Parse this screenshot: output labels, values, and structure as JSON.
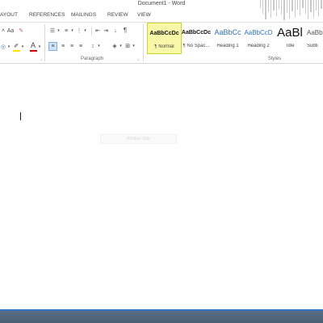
{
  "window": {
    "title": "Document1 - Word"
  },
  "ribbon_tabs": [
    "AYOUT",
    "REFERENCES",
    "MAILINGS",
    "REVIEW",
    "VIEW"
  ],
  "font_group": {
    "font_color_glyph": "A",
    "highlight_icon": "highlighter-icon",
    "text_effects_icon": "text-effects-icon"
  },
  "paragraph_group": {
    "label": "Paragraph",
    "show_marks_glyph": "¶",
    "bullets_icon": "bullets-icon",
    "numbering_icon": "numbering-icon",
    "multilevel_icon": "multilevel-list-icon",
    "decrease_indent_icon": "decrease-indent-icon",
    "increase_indent_icon": "increase-indent-icon",
    "sort_icon": "sort-icon",
    "align_left_icon": "align-left-icon",
    "align_center_icon": "align-center-icon",
    "align_right_icon": "align-right-icon",
    "justify_icon": "justify-icon",
    "line_spacing_icon": "line-spacing-icon",
    "shading_icon": "shading-icon",
    "borders_icon": "borders-icon"
  },
  "styles_group": {
    "label": "Styles",
    "items": [
      {
        "sample": "AaBbCcDc",
        "name": "¶ Normal",
        "active": true
      },
      {
        "sample": "AaBbCcDc",
        "name": "¶ No Spac...",
        "active": false
      },
      {
        "sample": "AaBbCc",
        "name": "Heading 1",
        "active": false
      },
      {
        "sample": "AaBbCcD",
        "name": "Heading 2",
        "active": false
      },
      {
        "sample": "AaBl",
        "name": "Title",
        "active": false
      },
      {
        "sample": "AaBbCcD",
        "name": "Subti",
        "active": false
      }
    ]
  },
  "document": {
    "ghost_label": "Window Snip"
  },
  "colors": {
    "font_color": "#d00000",
    "highlight_color": "#ffe600",
    "style_accent": "#2e74b5",
    "selected_style_bg": "#f8f8a8",
    "taskbar": "#4f637a",
    "taskbar_accent": "#2e76c8"
  }
}
